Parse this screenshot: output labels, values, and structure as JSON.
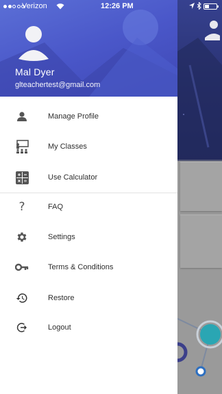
{
  "status_bar": {
    "carrier": "Verizon",
    "time": "12:26 PM",
    "battery_level": 0.35
  },
  "drawer": {
    "user": {
      "name": "Mal Dyer",
      "email": "glteachertest@gmail.com"
    },
    "menu": [
      {
        "id": "manage-profile",
        "label": "Manage Profile",
        "icon": "person-icon"
      },
      {
        "id": "my-classes",
        "label": "My Classes",
        "icon": "classroom-icon"
      },
      {
        "id": "use-calculator",
        "label": "Use Calculator",
        "icon": "calculator-icon"
      },
      {
        "id": "faq",
        "label": "FAQ",
        "icon": "question-icon"
      },
      {
        "id": "settings",
        "label": "Settings",
        "icon": "gear-icon"
      },
      {
        "id": "terms",
        "label": "Terms & Conditions",
        "icon": "key-icon"
      },
      {
        "id": "restore",
        "label": "Restore",
        "icon": "restore-icon"
      },
      {
        "id": "logout",
        "label": "Logout",
        "icon": "logout-icon"
      }
    ]
  },
  "colors": {
    "header_gradient_start": "#5b6fd6",
    "header_gradient_end": "#3f48b5",
    "icon_gray": "#555555",
    "background_app_header": "#2e3675",
    "teal_accent": "#2aa6b3"
  }
}
